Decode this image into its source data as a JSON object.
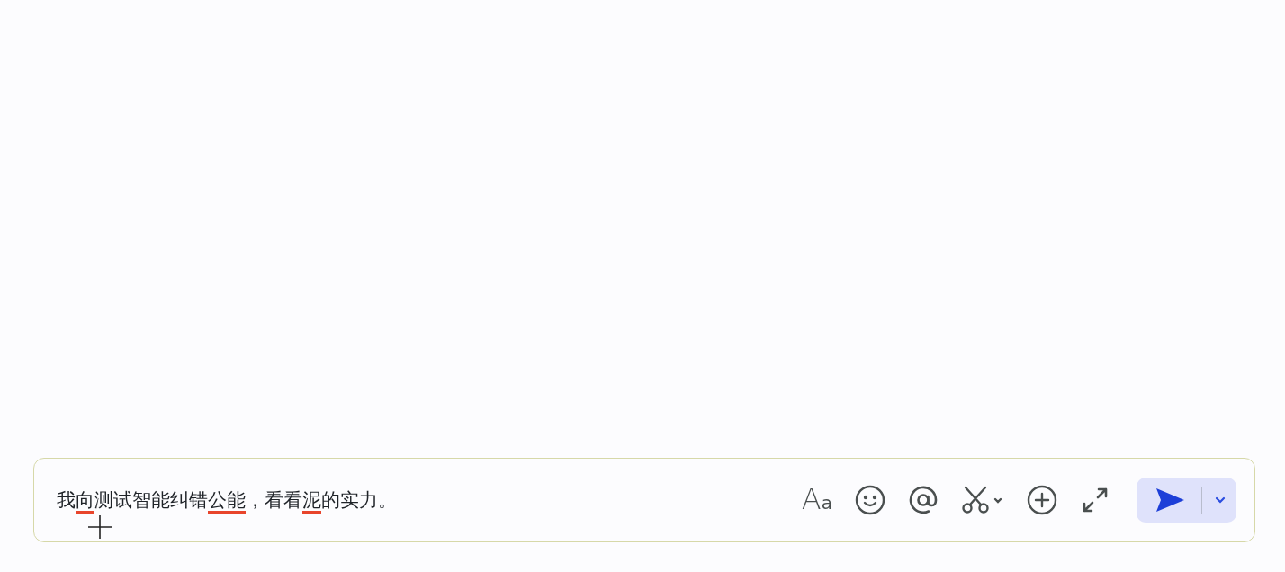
{
  "composer": {
    "segments": [
      {
        "text": "我",
        "misspelled": false
      },
      {
        "text": "向",
        "misspelled": true
      },
      {
        "text": "测试智能纠错",
        "misspelled": false
      },
      {
        "text": "公能",
        "misspelled": true
      },
      {
        "text": "，看看",
        "misspelled": false
      },
      {
        "text": "泥",
        "misspelled": true
      },
      {
        "text": "的实力。",
        "misspelled": false
      }
    ],
    "tools": [
      {
        "kind": "format",
        "glyph": "Aa"
      },
      {
        "kind": "emoji"
      },
      {
        "kind": "mention"
      },
      {
        "kind": "screenshot"
      },
      {
        "kind": "add"
      },
      {
        "kind": "expand"
      }
    ],
    "send": {
      "kind": "send"
    }
  }
}
